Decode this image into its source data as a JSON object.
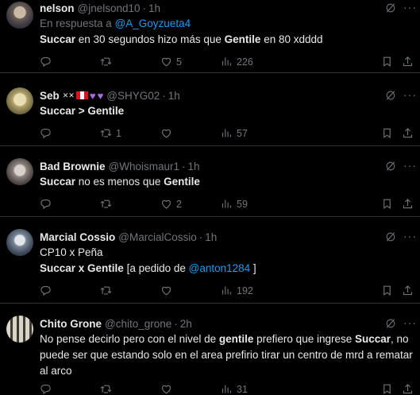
{
  "tweets": [
    {
      "name": "nelson",
      "handle": "@jnelsond10",
      "time": "1h",
      "reply_prefix": "En respuesta a",
      "reply_handle": "@A_Goyzueta4",
      "text_parts": [
        {
          "t": "Succar",
          "b": true
        },
        {
          "t": " en 30 segundos hizo más que ",
          "b": false
        },
        {
          "t": "Gentile",
          "b": true
        },
        {
          "t": " en 80 xdddd",
          "b": false
        }
      ],
      "replies": "",
      "retweets": "",
      "likes": "5",
      "views": "226"
    },
    {
      "name": "Seb",
      "emojis": [
        "vs-icon",
        "peru-flag-icon",
        "purple-heart-icon",
        "purple-heart-icon"
      ],
      "handle": "@SHYG02",
      "time": "1h",
      "text_parts": [
        {
          "t": "Succar > Gentile",
          "b": true
        }
      ],
      "replies": "",
      "retweets": "1",
      "likes": "",
      "views": "57"
    },
    {
      "name": "Bad Brownie",
      "handle": "@Whoismaur1",
      "time": "1h",
      "text_parts": [
        {
          "t": "Succar",
          "b": true
        },
        {
          "t": " no es menos que ",
          "b": false
        },
        {
          "t": "Gentile",
          "b": true
        }
      ],
      "replies": "",
      "retweets": "",
      "likes": "2",
      "views": "59"
    },
    {
      "name": "Marcial Cossio",
      "handle": "@MarcialCossio",
      "time": "1h",
      "line1": "CP10 x Peña",
      "text_parts": [
        {
          "t": "Succar x Gentile",
          "b": true
        },
        {
          "t": " [a pedido de ",
          "b": false
        },
        {
          "t": "@anton1284",
          "b": false,
          "m": true
        },
        {
          "t": " ]",
          "b": false
        }
      ],
      "replies": "",
      "retweets": "",
      "likes": "",
      "views": "192"
    },
    {
      "name": "Chito Grone",
      "handle": "@chito_grone",
      "time": "2h",
      "text_parts": [
        {
          "t": "No pense decirlo pero con el nivel de ",
          "b": false
        },
        {
          "t": "gentile",
          "b": true
        },
        {
          "t": " prefiero que ingrese ",
          "b": false
        },
        {
          "t": "Succar",
          "b": true
        },
        {
          "t": ", no puede ser que estando solo en el area prefirio tirar un centro de mrd a rematar al arco",
          "b": false
        }
      ],
      "replies": "",
      "retweets": "",
      "likes": "",
      "views": "31"
    }
  ],
  "colors": {
    "background": "#000000",
    "text": "#e7e9ea",
    "muted": "#71767b",
    "link": "#1d9bf0",
    "divider": "#2f3336"
  },
  "icons": {
    "reply": "reply-icon",
    "retweet": "retweet-icon",
    "like": "heart-icon",
    "views": "views-icon",
    "bookmark": "bookmark-icon",
    "share": "share-icon",
    "grok": "grok-icon",
    "more": "more-icon"
  }
}
